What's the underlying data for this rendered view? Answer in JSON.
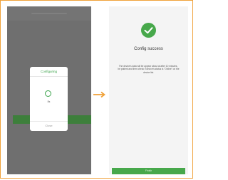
{
  "left_screen": {
    "dialog_title": "Configuring",
    "progress_text": "8s",
    "close_label": "Close"
  },
  "right_screen": {
    "title": "Config success",
    "description": "The device's data will be appear about at after 10 minutes , be patient and then check if device's status is \"Online\" on the device list.",
    "button_label": "Finish"
  },
  "colors": {
    "accent_green": "#3aa24a",
    "button_green": "#47a84b",
    "arrow_orange": "#f0a23a",
    "border_orange": "#f0a23a"
  },
  "icons": {
    "success": "check-circle-icon",
    "arrow": "arrow-right-icon",
    "progress": "loading-spinner-icon"
  }
}
